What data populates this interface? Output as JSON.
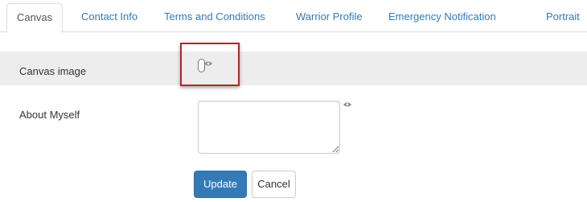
{
  "tabs": [
    {
      "label": "Canvas",
      "active": true
    },
    {
      "label": "Contact Info",
      "active": false
    },
    {
      "label": "Terms and Conditions",
      "active": false
    },
    {
      "label": "Warrior Profile",
      "active": false
    },
    {
      "label": "Emergency Notification",
      "active": false
    },
    {
      "label": "Portrait",
      "active": false
    }
  ],
  "form": {
    "canvas_image_label": "Canvas image",
    "about_label": "About Myself",
    "about_value": ""
  },
  "buttons": {
    "update_label": "Update",
    "cancel_label": "Cancel"
  },
  "icons": {
    "visibility": "eye-icon",
    "toggle": "toggle-switch"
  },
  "colors": {
    "link": "#337ab7",
    "primary": "#337ab7",
    "highlight": "#b3262b",
    "row_background": "#ededed"
  }
}
